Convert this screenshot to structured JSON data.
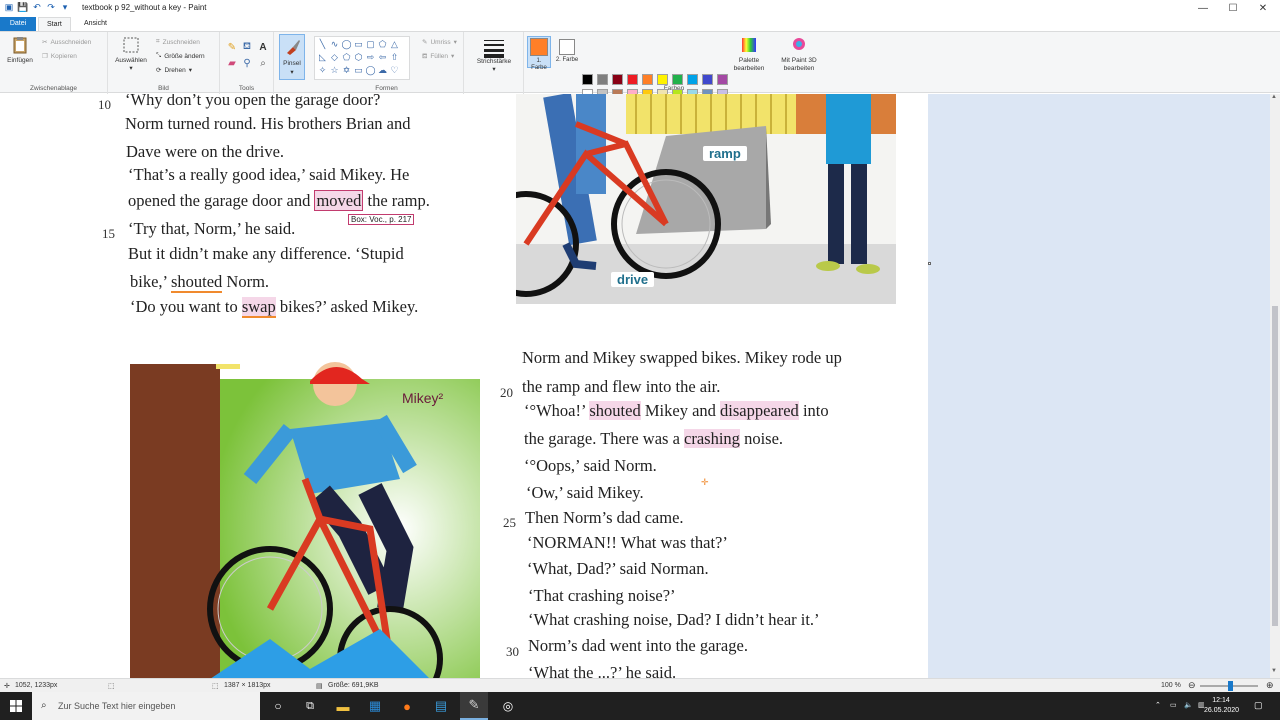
{
  "window": {
    "title": "textbook p 92_without a key - Paint",
    "controls": {
      "minimize": "—",
      "maximize": "☐",
      "close": "✕"
    }
  },
  "tabs": {
    "file": "Datei",
    "start": "Start",
    "view": "Ansicht"
  },
  "ribbon": {
    "clipboard": {
      "paste": "Einfügen",
      "cut": "Ausschneiden",
      "copy": "Kopieren",
      "label": "Zwischenablage"
    },
    "image": {
      "select": "Auswählen",
      "crop": "Zuschneiden",
      "resize": "Größe ändern",
      "rotate": "Drehen",
      "label": "Bild"
    },
    "tools": {
      "label": "Tools"
    },
    "brush": {
      "label": "Pinsel"
    },
    "shapes": {
      "outline": "Umriss",
      "fill": "Füllen",
      "label": "Formen"
    },
    "stroke": {
      "label": "Strichstärke"
    },
    "colors": {
      "color1": "1. Farbe",
      "color2": "2. Farbe",
      "edit": "Palette bearbeiten",
      "paint3d": "Mit Paint 3D bearbeiten",
      "label": "Farben",
      "palette_row1": [
        "#000000",
        "#7f7f7f",
        "#880015",
        "#ed1c24",
        "#ff7f27",
        "#fff200",
        "#22b14c",
        "#00a2e8",
        "#3f48cc",
        "#a349a4"
      ],
      "palette_row2": [
        "#ffffff",
        "#c3c3c3",
        "#b97a57",
        "#ffaec9",
        "#ffc90e",
        "#efe4b0",
        "#b5e61d",
        "#99d9ea",
        "#7092be",
        "#c8bfe7"
      ]
    }
  },
  "page": {
    "lines_left": [
      {
        "num": "10",
        "text": "‘Why don’t you open the garage door?"
      },
      {
        "num": "",
        "text": "Norm turned round. His brothers Brian and"
      },
      {
        "num": "",
        "text": "Dave were on the drive."
      },
      {
        "num": "",
        "text": "‘That’s a really good idea,’ said Mikey. He"
      }
    ],
    "line_moved": {
      "before": "opened the garage door and ",
      "word": "moved",
      "after": " the ramp."
    },
    "voc_box": "Box: Voc., p. 217",
    "line_try": {
      "num": "15",
      "text": "‘Try that, Norm,’ he said."
    },
    "line_but": "But it didn’t make any difference. ‘Stupid",
    "line_bike": {
      "before": "bike,’ ",
      "word": "shouted",
      "after": " Norm."
    },
    "line_swap": {
      "before": "‘Do you want to ",
      "word": "swap",
      "after": " bikes?’ asked Mikey."
    },
    "labels": {
      "ramp": "ramp",
      "drive": "drive",
      "mikey": "Mikey²"
    },
    "right": {
      "l1": "Norm and Mikey swapped bikes. Mikey rode up",
      "n20": "20",
      "l2": "the ramp and flew into the air.",
      "l3a": "‘°Whoa!’ ",
      "l3b": "shouted",
      "l3c": " Mikey and ",
      "l3d": "disappeared",
      "l3e": " into",
      "l4a": "the garage. There was a ",
      "l4b": "crashing",
      "l4c": " noise.",
      "l5": "‘°Oops,’ said Norm.",
      "l6": "‘Ow,’ said Mikey.",
      "n25": "25",
      "l7": "Then Norm’s dad came.",
      "l8": "‘NORMAN!! What was that?’",
      "l9": "‘What, Dad?’ said Norman.",
      "l10": "‘That crashing noise?’",
      "l11": "‘What crashing noise, Dad? I didn’t hear it.’",
      "n30": "30",
      "l12": "Norm’s dad went into the garage.",
      "l13": "‘What the ...?’ he said."
    }
  },
  "status": {
    "cursor": "1052, 1233px",
    "size": "1387 × 1813px",
    "file_size": "Größe: 691,9KB",
    "zoom": "100 %"
  },
  "taskbar": {
    "search_placeholder": "Zur Suche Text hier eingeben",
    "time": "12:14",
    "date": "26.05.2020"
  }
}
